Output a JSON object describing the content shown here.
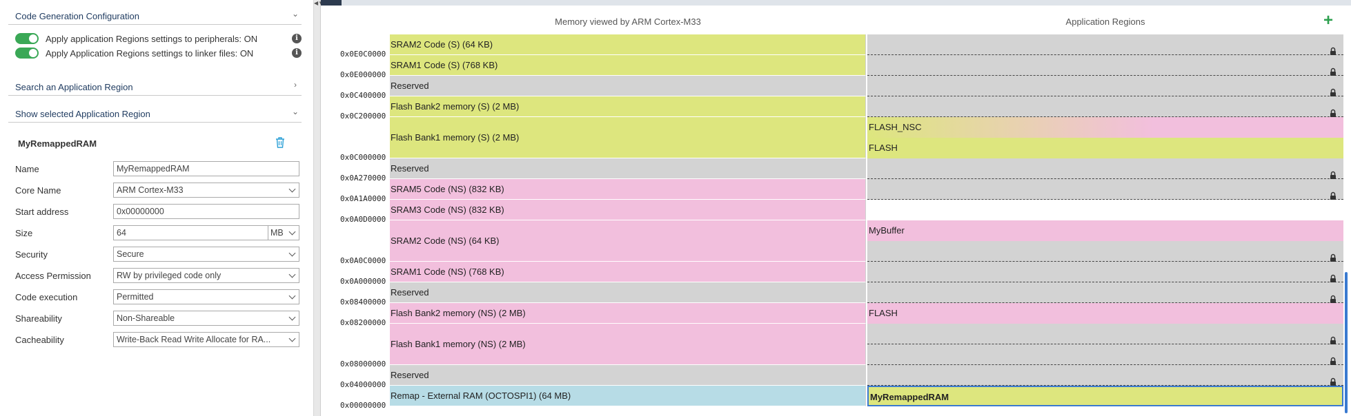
{
  "left": {
    "code_gen": {
      "title": "Code Generation Configuration",
      "toggle1": "Apply application Regions settings to peripherals: ON",
      "toggle2": "Apply Application Regions settings to linker files: ON"
    },
    "search_section": "Search an Application Region",
    "show_section": "Show selected Application Region",
    "region_title": "MyRemappedRAM",
    "fields": {
      "name": {
        "label": "Name",
        "value": "MyRemappedRAM"
      },
      "core": {
        "label": "Core Name",
        "value": "ARM Cortex-M33"
      },
      "start": {
        "label": "Start address",
        "value": "0x00000000"
      },
      "size": {
        "label": "Size",
        "value": "64",
        "unit": "MB"
      },
      "security": {
        "label": "Security",
        "value": "Secure"
      },
      "access": {
        "label": "Access Permission",
        "value": "RW by privileged code only"
      },
      "exec": {
        "label": "Code execution",
        "value": "Permitted"
      },
      "share": {
        "label": "Shareability",
        "value": "Non-Shareable"
      },
      "cache": {
        "label": "Cacheability",
        "value": "Write-Back Read Write Allocate for RA..."
      }
    }
  },
  "right": {
    "memory_header": "Memory viewed by ARM Cortex-M33",
    "regions_header": "Application Regions",
    "add_icon": "plus-icon",
    "memory_map": [
      {
        "label": "SRAM2 Code (S) (64 KB)",
        "addr": "0x0E0C0000",
        "color": "#dde67e"
      },
      {
        "label": "SRAM1 Code (S) (768 KB)",
        "addr": "0x0E000000",
        "color": "#dde67e"
      },
      {
        "label": "Reserved",
        "addr": "0x0C400000",
        "color": "#d3d3d3"
      },
      {
        "label": "Flash Bank2 memory (S) (2 MB)",
        "addr": "0x0C200000",
        "color": "#dde67e"
      },
      {
        "label": "Flash Bank1 memory (S) (2 MB)",
        "addr": "0x0C000000",
        "color": "#dde67e"
      },
      {
        "label": "Reserved",
        "addr": "0x0A270000",
        "color": "#d3d3d3"
      },
      {
        "label": "SRAM5 Code (NS) (832 KB)",
        "addr": "0x0A1A0000",
        "color": "#f2bfdd"
      },
      {
        "label": "SRAM3 Code (NS) (832 KB)",
        "addr": "0x0A0D0000",
        "color": "#f2bfdd"
      },
      {
        "label": "SRAM2 Code (NS) (64 KB)",
        "addr": "0x0A0C0000",
        "color": "#f2bfdd"
      },
      {
        "label": "SRAM1 Code (NS) (768 KB)",
        "addr": "0x0A000000",
        "color": "#f2bfdd"
      },
      {
        "label": "Reserved",
        "addr": "0x08400000",
        "color": "#d3d3d3"
      },
      {
        "label": "Flash Bank2 memory (NS) (2 MB)",
        "addr": "0x08200000",
        "color": "#f2bfdd"
      },
      {
        "label": "Flash Bank1 memory (NS) (2 MB)",
        "addr": "0x08000000",
        "color": "#f2bfdd"
      },
      {
        "label": "Reserved",
        "addr": "0x04000000",
        "color": "#d3d3d3"
      },
      {
        "label": "Remap - External RAM (OCTOSPI1) (64 MB)",
        "addr": "0x00000000",
        "color": "#b7dce6"
      }
    ],
    "app_regions": [
      {
        "label": "",
        "color": "#d3d3d3",
        "locked": true
      },
      {
        "label": "",
        "color": "#d3d3d3",
        "locked": true
      },
      {
        "label": "",
        "color": "#d3d3d3",
        "locked": true
      },
      {
        "label": "",
        "color": "#d3d3d3",
        "locked": true
      },
      {
        "label": "FLASH_NSC",
        "color": "gradient-nsc",
        "locked": false
      },
      {
        "label": "FLASH",
        "color": "#dde67e",
        "locked": false
      },
      {
        "label": "",
        "color": "#d3d3d3",
        "locked": true
      },
      {
        "label": "",
        "color": "#d3d3d3",
        "locked": true
      },
      {
        "label": "",
        "color": "#ffffff",
        "locked": false
      },
      {
        "label": "MyBuffer",
        "color": "#f2bfdd",
        "locked": false
      },
      {
        "label": "",
        "color": "#d3d3d3",
        "locked": true
      },
      {
        "label": "",
        "color": "#d3d3d3",
        "locked": true
      },
      {
        "label": "",
        "color": "#d3d3d3",
        "locked": true
      },
      {
        "label": "FLASH",
        "color": "#f2bfdd",
        "locked": false
      },
      {
        "label": "",
        "color": "#d3d3d3",
        "locked": true
      },
      {
        "label": "",
        "color": "#d3d3d3",
        "locked": true
      },
      {
        "label": "",
        "color": "#d3d3d3",
        "locked": true
      },
      {
        "label": "MyRemappedRAM",
        "color": "#dde67e",
        "locked": false
      }
    ]
  }
}
